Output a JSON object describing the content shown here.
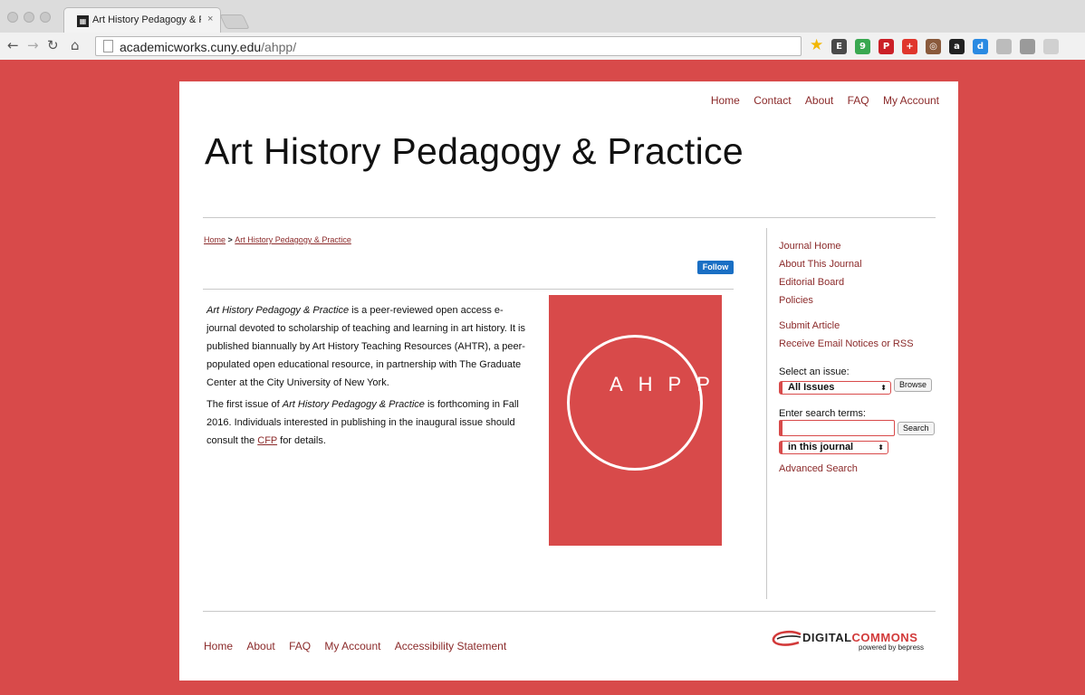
{
  "browser": {
    "tab_title": "Art History Pedagogy & Pr...",
    "tab_close": "×",
    "url_host": "academicworks.cuny.edu",
    "url_path": "/ahpp/",
    "extensions": [
      {
        "name": "evernote-extension-icon",
        "color": "#4a4a4a",
        "glyph": "E"
      },
      {
        "name": "hangouts-extension-icon",
        "color": "#3aa851",
        "glyph": "9"
      },
      {
        "name": "pinterest-extension-icon",
        "color": "#cb2027",
        "glyph": "P"
      },
      {
        "name": "plus-extension-icon",
        "color": "#e0362c",
        "glyph": "+"
      },
      {
        "name": "instagram-extension-icon",
        "color": "#8a5a3c",
        "glyph": "◎"
      },
      {
        "name": "amazon-extension-icon",
        "color": "#222222",
        "glyph": "a"
      },
      {
        "name": "diigo-extension-icon",
        "color": "#2a8ae2",
        "glyph": "d"
      },
      {
        "name": "page-extension-icon",
        "color": "#bcbcbc",
        "glyph": ""
      },
      {
        "name": "square-extension-icon",
        "color": "#9a9a9a",
        "glyph": ""
      },
      {
        "name": "menu-extension-icon",
        "color": "#d0d0d0",
        "glyph": ""
      }
    ]
  },
  "topnav": [
    "Home",
    "Contact",
    "About",
    "FAQ",
    "My Account"
  ],
  "site_title": "Art History Pedagogy & Practice",
  "breadcrumb": {
    "home": "Home",
    "sep": " > ",
    "current": "Art History Pedagogy & Practice"
  },
  "follow_label": "Follow",
  "intro": {
    "p1_em": "Art History Pedagogy & Practice",
    "p1_rest": " is a peer-reviewed open access e-journal devoted to scholarship of teaching and learning in art history. It is published biannually by Art History Teaching Resources (AHTR), a peer-populated open educational resource, in partnership with The Graduate Center at the City University of New York.",
    "p2_start": "The first issue of ",
    "p2_em": "Art History Pedagogy & Practice",
    "p2_mid": " is forthcoming in Fall 2016. Individuals interested in publishing in the inaugural issue should consult the ",
    "p2_link": "CFP",
    "p2_end": " for details."
  },
  "cover": {
    "letters": "AHPP",
    "color": "#d84a4a"
  },
  "sidebar": {
    "links1": [
      "Journal Home",
      "About This Journal",
      "Editorial Board",
      "Policies"
    ],
    "links2": [
      "Submit Article",
      "Receive Email Notices or RSS"
    ],
    "select_issue_label": "Select an issue:",
    "issue_value": "All Issues",
    "browse_label": "Browse",
    "search_label": "Enter search terms:",
    "search_button": "Search",
    "scope_value": "in this journal",
    "advanced_search": "Advanced Search"
  },
  "footnav": [
    "Home",
    "About",
    "FAQ",
    "My Account",
    "Accessibility Statement"
  ],
  "logo": {
    "digital": "DIGITAL",
    "commons": "COMMONS",
    "powered": "powered by bepress"
  }
}
